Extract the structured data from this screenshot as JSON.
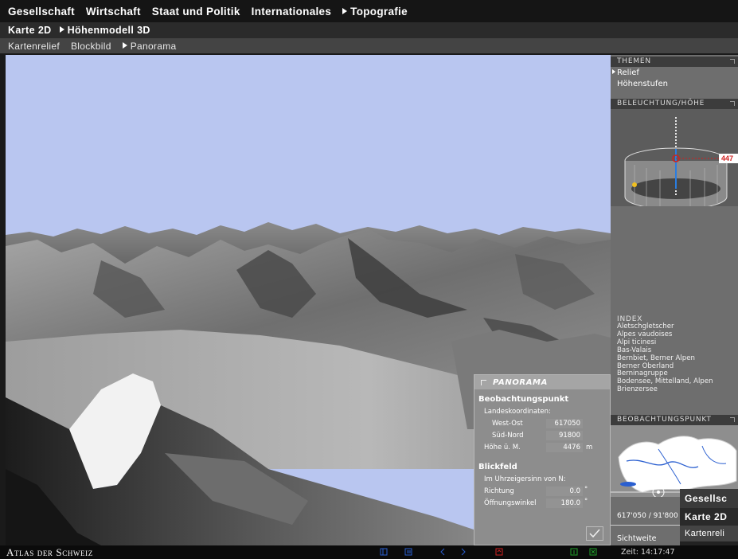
{
  "nav": {
    "primary": [
      "Gesellschaft",
      "Wirtschaft",
      "Staat und Politik",
      "Internationales",
      "Topografie"
    ],
    "secondary": [
      "Karte 2D",
      "Höhenmodell 3D"
    ],
    "tertiary": [
      "Kartenrelief",
      "Blockbild",
      "Panorama"
    ]
  },
  "side": {
    "themen_title": "THEMEN",
    "themen_items": [
      "Relief",
      "Höhenstufen"
    ],
    "light_title": "BELEUCHTUNG/HÖHE",
    "height_tag": "447",
    "index_title": "INDEX",
    "index_items": [
      "Aletschgletscher",
      "Alpes vaudoises",
      "Alpi ticinesi",
      "Bas-Valais",
      "Bernbiet, Berner Alpen",
      "Berner Oberland",
      "Berninagruppe",
      "Bodensee, Mittelland, Alpen",
      "Brienzersee"
    ],
    "obs_title": "BEOBACHTUNGSPUNKT",
    "coords": "617'050 / 91'800",
    "sichtweite": "Sichtweite"
  },
  "panorama": {
    "title": "PANORAMA",
    "obs_heading": "Beobachtungspunkt",
    "coord_label": "Landeskoordinaten:",
    "west_ost_label": "West-Ost",
    "west_ost_value": "617050",
    "sued_nord_label": "Süd-Nord",
    "sued_nord_value": "91800",
    "hoehe_label": "Höhe ü. M.",
    "hoehe_value": "4476",
    "hoehe_unit": "m",
    "field_heading": "Blickfeld",
    "field_sub": "Im Uhrzeigersinn von N:",
    "richtung_label": "Richtung",
    "richtung_value": "0.0",
    "oeffnung_label": "Öffnungswinkel",
    "oeffnung_value": "180.0",
    "degree": "°"
  },
  "status": {
    "brand": "Atlas der Schweiz",
    "time": "Zeit: 14:17:47"
  },
  "ghost": {
    "line1": "Gesellsc",
    "line2": "Karte 2D",
    "line3": "Kartenreli"
  },
  "colors": {
    "sky": "#b9c6f0",
    "accent_red": "#d02020",
    "status_blue": "#2a5fd0",
    "status_green": "#1fa02a"
  }
}
